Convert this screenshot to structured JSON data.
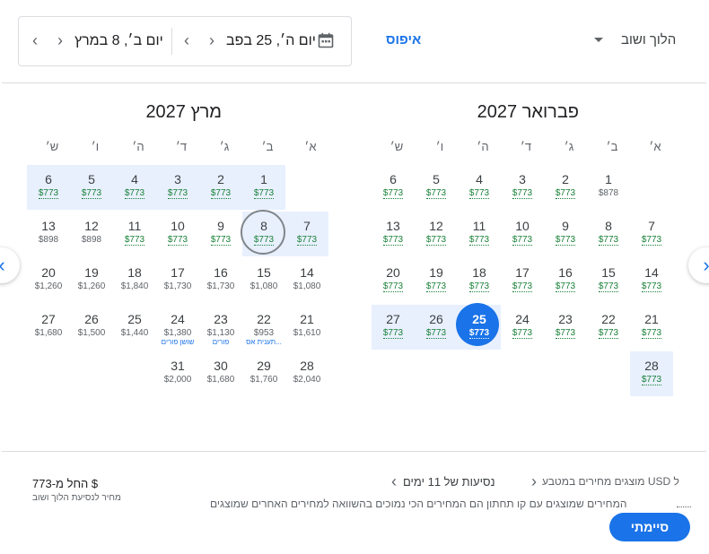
{
  "header": {
    "trip_type": "הלוך ושוב",
    "reset": "איפוס",
    "departure_date": "יום ה׳, 25 בפב",
    "return_date": "יום ב׳, 8 במרץ"
  },
  "weekdays": [
    "א׳",
    "ב׳",
    "ג׳",
    "ד׳",
    "ה׳",
    "ו׳",
    "ש׳"
  ],
  "months": [
    {
      "title": "פברואר 2027",
      "rows": [
        [
          null,
          {
            "d": "1",
            "p": "$878"
          },
          {
            "d": "2",
            "p": "$773"
          },
          {
            "d": "3",
            "p": "$773"
          },
          {
            "d": "4",
            "p": "$773"
          },
          {
            "d": "5",
            "p": "$773"
          },
          {
            "d": "6",
            "p": "$773"
          }
        ],
        [
          {
            "d": "7",
            "p": "$773"
          },
          {
            "d": "8",
            "p": "$773"
          },
          {
            "d": "9",
            "p": "$773"
          },
          {
            "d": "10",
            "p": "$773"
          },
          {
            "d": "11",
            "p": "$773"
          },
          {
            "d": "12",
            "p": "$773"
          },
          {
            "d": "13",
            "p": "$773"
          }
        ],
        [
          {
            "d": "14",
            "p": "$773"
          },
          {
            "d": "15",
            "p": "$773"
          },
          {
            "d": "16",
            "p": "$773"
          },
          {
            "d": "17",
            "p": "$773"
          },
          {
            "d": "18",
            "p": "$773"
          },
          {
            "d": "19",
            "p": "$773"
          },
          {
            "d": "20",
            "p": "$773"
          }
        ],
        [
          {
            "d": "21",
            "p": "$773"
          },
          {
            "d": "22",
            "p": "$773"
          },
          {
            "d": "23",
            "p": "$773"
          },
          {
            "d": "24",
            "p": "$773"
          },
          {
            "d": "25",
            "p": "$773",
            "sel": true
          },
          {
            "d": "26",
            "p": "$773"
          },
          {
            "d": "27",
            "p": "$773"
          }
        ],
        [
          {
            "d": "28",
            "p": "$773"
          },
          null,
          null,
          null,
          null,
          null,
          null
        ]
      ]
    },
    {
      "title": "מרץ 2027",
      "rows": [
        [
          null,
          {
            "d": "1",
            "p": "$773"
          },
          {
            "d": "2",
            "p": "$773"
          },
          {
            "d": "3",
            "p": "$773"
          },
          {
            "d": "4",
            "p": "$773"
          },
          {
            "d": "5",
            "p": "$773"
          },
          {
            "d": "6",
            "p": "$773"
          }
        ],
        [
          {
            "d": "7",
            "p": "$773"
          },
          {
            "d": "8",
            "p": "$773",
            "cur": true
          },
          {
            "d": "9",
            "p": "$773"
          },
          {
            "d": "10",
            "p": "$773"
          },
          {
            "d": "11",
            "p": "$773"
          },
          {
            "d": "12",
            "p": "$898"
          },
          {
            "d": "13",
            "p": "$898"
          }
        ],
        [
          {
            "d": "14",
            "p": "$1,080"
          },
          {
            "d": "15",
            "p": "$1,080"
          },
          {
            "d": "16",
            "p": "$1,730"
          },
          {
            "d": "17",
            "p": "$1,730"
          },
          {
            "d": "18",
            "p": "$1,840"
          },
          {
            "d": "19",
            "p": "$1,260"
          },
          {
            "d": "20",
            "p": "$1,260"
          }
        ],
        [
          {
            "d": "21",
            "p": "$1,610"
          },
          {
            "d": "22",
            "p": "$953",
            "h": "תענית אס..."
          },
          {
            "d": "23",
            "p": "$1,130",
            "h": "פורים"
          },
          {
            "d": "24",
            "p": "$1,380",
            "h": "שושן פורים"
          },
          {
            "d": "25",
            "p": "$1,440"
          },
          {
            "d": "26",
            "p": "$1,500"
          },
          {
            "d": "27",
            "p": "$1,680"
          }
        ],
        [
          {
            "d": "28",
            "p": "$2,040"
          },
          {
            "d": "29",
            "p": "$1,760"
          },
          {
            "d": "30",
            "p": "$1,680"
          },
          {
            "d": "31",
            "p": "$2,000"
          },
          null,
          null,
          null
        ]
      ]
    }
  ],
  "footer": {
    "currency_note": "מוצגים מחירים במטבע USD ל",
    "trip_length": "נסיעות של 11 ימים",
    "low_price_note": "המחירים שמוצגים עם קו תחתון הם המחירים הכי נמוכים בהשוואה למחירים האחרים שמוצגים",
    "price_from": "החל מ-773 $",
    "price_sub": "מחיר לנסיעת הלוך ושוב",
    "done": "סיימתי"
  },
  "colors": {
    "accent": "#1a73e8",
    "range": "#e8f0fe",
    "low_price": "#188038"
  }
}
